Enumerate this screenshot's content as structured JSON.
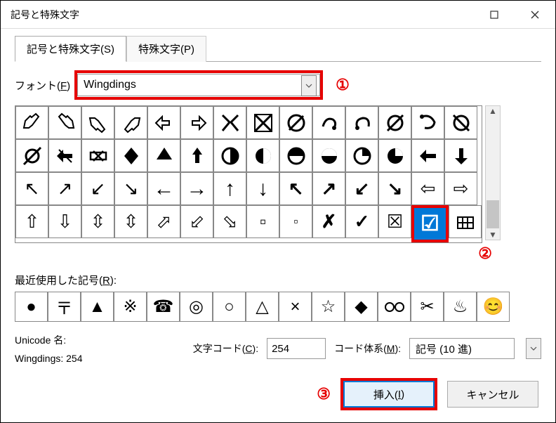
{
  "titlebar": {
    "title": "記号と特殊文字"
  },
  "tabs": {
    "tab1": "記号と特殊文字(S)",
    "tab2": "特殊文字(P)"
  },
  "font": {
    "label": "フォント(F)",
    "value": "Wingdings"
  },
  "annotations": {
    "a1": "①",
    "a2": "②",
    "a3": "③"
  },
  "recent": {
    "label": "最近使用した記号(R):"
  },
  "unicode": {
    "name_label": "Unicode 名:",
    "name_value": "Wingdings: 254",
    "code_label": "文字コード(C):",
    "code_value": "254",
    "system_label": "コード体系(M):",
    "system_value": "記号 (10 進)"
  },
  "buttons": {
    "insert": "挿入(I)",
    "cancel": "キャンセル"
  },
  "grid": {
    "selected_glyph": "☑"
  }
}
